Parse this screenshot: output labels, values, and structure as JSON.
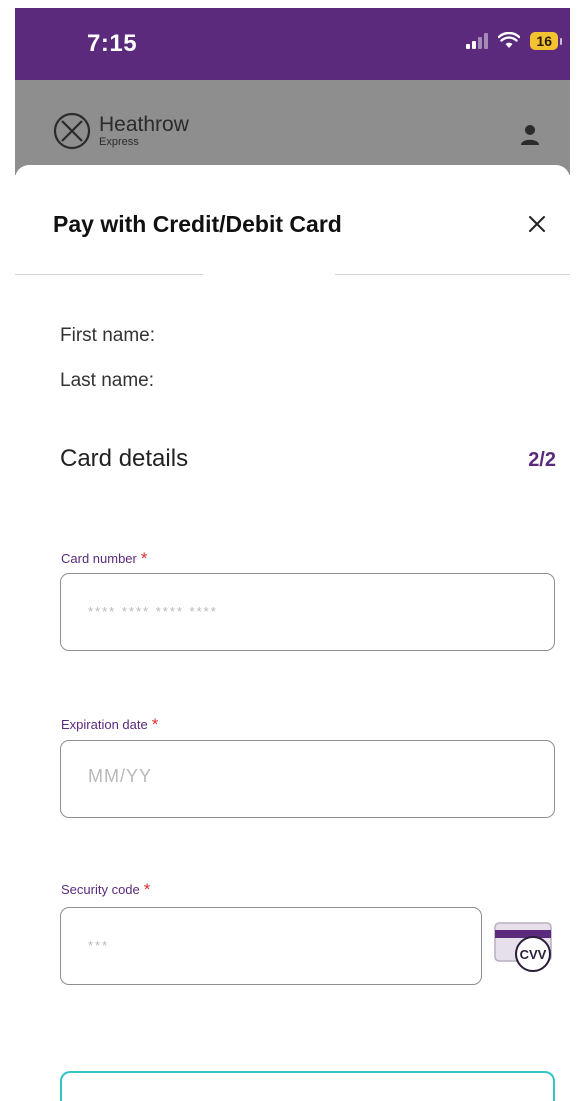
{
  "status_bar": {
    "time": "7:15",
    "battery": "16"
  },
  "header": {
    "logo_name": "Heathrow",
    "logo_sub": "Express"
  },
  "sheet": {
    "title": "Pay with Credit/Debit Card",
    "first_name_label": "First name:",
    "last_name_label": "Last name:",
    "section_title": "Card details",
    "step": "2/2"
  },
  "form": {
    "card_number": {
      "label": "Card number",
      "required": "*",
      "placeholder": "**** **** **** ****"
    },
    "expiration": {
      "label": "Expiration date",
      "required": "*",
      "placeholder": "MM/YY"
    },
    "security": {
      "label": "Security code",
      "required": "*",
      "placeholder": "***",
      "icon_text": "CVV"
    }
  },
  "colors": {
    "brand_purple": "#5b2a7d",
    "accent_teal": "#31c6c4",
    "required_red": "#d93030"
  }
}
